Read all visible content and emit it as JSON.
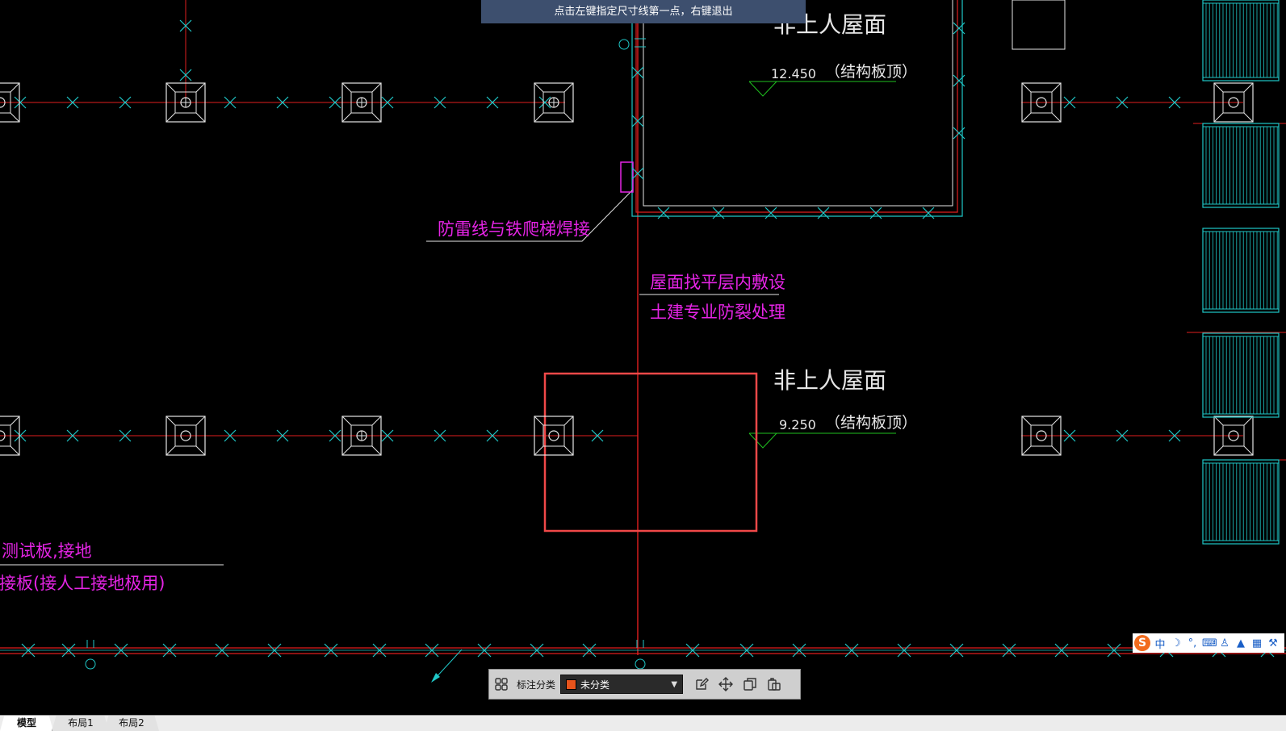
{
  "hint": "点击左键指定尺寸线第一点，右键退出",
  "labels": {
    "roof_top": "非上人屋面",
    "roof_top_elev": "12.450",
    "roof_top_note": "（结构板顶）",
    "roof_mid": "非上人屋面",
    "roof_mid_elev": "9.250",
    "roof_mid_note": "（结构板顶）",
    "weld_note": "防雷线与铁爬梯焊接",
    "lay_note_1": "屋面找平层内敷设",
    "lay_note_2": "土建专业防裂处理",
    "test_note_1": "测试板,接地",
    "test_note_2": "连接板(接人工接地极用)"
  },
  "toolbar": {
    "category_label": "标注分类",
    "category_value": "未分类",
    "swatch_color": "#e8541c"
  },
  "ime": {
    "logo": "S",
    "lang": "中"
  },
  "tabs": [
    "模型",
    "布局1",
    "布局2"
  ],
  "colors": {
    "red": "#e01e1e",
    "cyan": "#1fc7c7",
    "magenta": "#e524e5",
    "white": "#e6e6e6",
    "green": "#1fbf1f",
    "highlight": "#f04848"
  }
}
